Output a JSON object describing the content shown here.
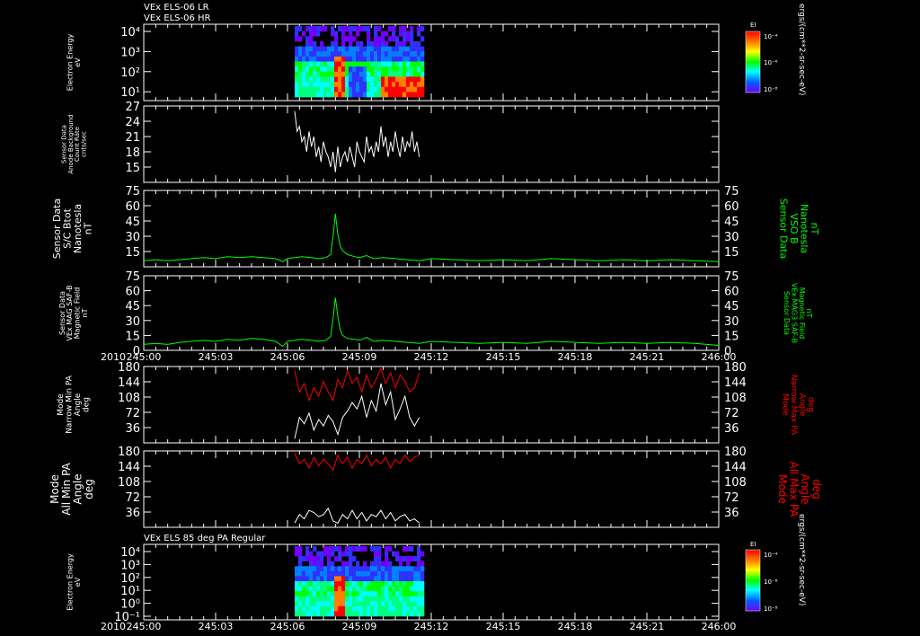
{
  "titles": {
    "top_line1": "VEx ELS-06 LR",
    "top_line2": "VEx ELS-06 HR",
    "bottom": "VEx ELS 85 deg PA Regular"
  },
  "time_axis": {
    "year": "2010",
    "ticks": [
      "245:00",
      "245:03",
      "245:06",
      "245:09",
      "245:12",
      "245:15",
      "245:18",
      "245:21",
      "246:00"
    ],
    "range_minutes": [
      0,
      24
    ]
  },
  "colorbar": {
    "label": "EI",
    "units": "ergs/(cm**2-sr-sec-eV)",
    "top_ticks": [
      "10⁻⁴",
      "10⁻⁶",
      "10⁻⁸"
    ],
    "bottom_ticks": [
      "10⁻⁴",
      "10⁻⁶",
      "10⁻⁸"
    ],
    "colors": [
      "#ff0000",
      "#ff8000",
      "#ffff00",
      "#00ff00",
      "#00ffff",
      "#0060ff",
      "#7000ff"
    ]
  },
  "colors": {
    "white": "#ffffff",
    "green": "#00ff00",
    "red": "#ff0000",
    "axis": "#ffffff"
  },
  "chart_data": [
    {
      "id": "spectrogram_top",
      "type": "heatmap",
      "ylabel_lines": [
        "Electron Energy",
        "eV"
      ],
      "y_scale": "log",
      "y_ticks": [
        "10⁴",
        "10³",
        "10²",
        "10¹"
      ],
      "x_range_minutes": [
        6.3,
        11.7
      ],
      "description_values": {
        "peak_time_minutes": 8.1
      }
    },
    {
      "id": "background_count",
      "type": "line",
      "ylabel_lines": [
        "Sensor Data",
        "Anode Background",
        "Count Rate",
        "cnts/sec"
      ],
      "ylim": [
        12,
        27
      ],
      "y_ticks": [
        15,
        18,
        21,
        24,
        27
      ],
      "series": [
        {
          "color": "white",
          "x": [
            6.3,
            6.4,
            6.5,
            6.6,
            6.7,
            6.8,
            6.9,
            7.0,
            7.1,
            7.2,
            7.3,
            7.4,
            7.5,
            7.6,
            7.7,
            7.8,
            7.9,
            8.0,
            8.1,
            8.2,
            8.3,
            8.4,
            8.5,
            8.6,
            8.7,
            8.8,
            8.9,
            9.0,
            9.1,
            9.2,
            9.3,
            9.4,
            9.5,
            9.6,
            9.7,
            9.8,
            9.9,
            10.0,
            10.1,
            10.2,
            10.3,
            10.4,
            10.5,
            10.6,
            10.7,
            10.8,
            10.9,
            11.0,
            11.1,
            11.2,
            11.3,
            11.4,
            11.5
          ],
          "y": [
            26,
            22,
            23,
            20,
            21,
            18,
            22,
            19,
            21,
            17,
            19,
            16,
            20,
            18,
            17,
            15,
            18,
            14,
            19,
            15,
            17,
            18,
            16,
            19,
            17,
            15,
            20,
            18,
            17,
            16,
            21,
            18,
            19,
            17,
            20,
            18,
            23,
            19,
            21,
            17,
            20,
            18,
            22,
            19,
            17,
            21,
            18,
            20,
            19,
            22,
            18,
            20,
            17
          ]
        }
      ]
    },
    {
      "id": "bmag_sc",
      "type": "line",
      "ylabel_lines": [
        "Sensor Data",
        "S/C Btot",
        "Nanotesla",
        "nT"
      ],
      "right_label_lines": [
        "Sensor Data",
        "VSO B",
        "Nanotesla",
        "nT"
      ],
      "ylim": [
        0,
        75
      ],
      "y_ticks": [
        15,
        30,
        45,
        60,
        75
      ],
      "series": [
        {
          "color": "green",
          "x": [
            0,
            0.5,
            1,
            1.5,
            2,
            2.5,
            3,
            3.5,
            4,
            4.5,
            5,
            5.5,
            5.8,
            6,
            6.3,
            6.6,
            7,
            7.3,
            7.6,
            7.8,
            7.9,
            8.0,
            8.1,
            8.2,
            8.3,
            8.5,
            8.8,
            9,
            9.3,
            9.6,
            10,
            10.5,
            11,
            11.5,
            12,
            13,
            14,
            15,
            16,
            17,
            18,
            19,
            20,
            21,
            22,
            23,
            24
          ],
          "y": [
            6,
            7,
            6,
            7,
            8,
            9,
            8,
            10,
            9,
            10,
            9,
            8,
            5,
            8,
            9,
            10,
            9,
            8,
            9,
            12,
            30,
            52,
            32,
            20,
            16,
            12,
            10,
            9,
            11,
            8,
            9,
            8,
            7,
            6,
            8,
            7,
            6,
            7,
            6,
            8,
            7,
            6,
            7,
            6,
            7,
            6,
            5
          ]
        }
      ]
    },
    {
      "id": "bmag_saf",
      "type": "line",
      "ylabel_lines": [
        "Sensor Data",
        "VEx MAG SAF-B",
        "Magnetic Field",
        "nT"
      ],
      "right_label_lines": [
        "Sensor Data",
        "VEx MAG3 SAF-B",
        "Magnetic Field",
        "nT"
      ],
      "ylim": [
        0,
        75
      ],
      "y_ticks": [
        0,
        15,
        30,
        45,
        60,
        75
      ],
      "series": [
        {
          "color": "green",
          "x": [
            0,
            0.5,
            1,
            1.5,
            2,
            2.5,
            3,
            3.5,
            4,
            4.5,
            5,
            5.5,
            5.8,
            6,
            6.3,
            6.6,
            7,
            7.3,
            7.6,
            7.8,
            7.9,
            8.0,
            8.1,
            8.2,
            8.3,
            8.5,
            8.8,
            9,
            9.3,
            9.6,
            10,
            10.5,
            11,
            11.5,
            12,
            13,
            14,
            15,
            16,
            17,
            18,
            19,
            20,
            21,
            22,
            23,
            24
          ],
          "y": [
            6,
            7,
            6,
            8,
            9,
            10,
            9,
            11,
            10,
            12,
            11,
            9,
            4,
            9,
            10,
            11,
            10,
            9,
            10,
            14,
            32,
            53,
            34,
            21,
            15,
            12,
            11,
            10,
            13,
            9,
            10,
            9,
            8,
            7,
            9,
            8,
            7,
            8,
            7,
            9,
            8,
            7,
            8,
            7,
            8,
            7,
            5
          ]
        }
      ]
    },
    {
      "id": "narrow_pa",
      "type": "line",
      "ylabel_lines": [
        "Mode",
        "Narrow Min PA",
        "Angle",
        "deg"
      ],
      "right_label_lines": [
        "Mode",
        "Narrow Max PA",
        "Angle",
        "deg"
      ],
      "ylim": [
        0,
        180
      ],
      "y_ticks": [
        36,
        72,
        108,
        144,
        180
      ],
      "series": [
        {
          "name": "Narrow Min PA",
          "color": "white",
          "x": [
            6.3,
            6.5,
            6.7,
            6.9,
            7.1,
            7.3,
            7.5,
            7.7,
            7.9,
            8.1,
            8.3,
            8.5,
            8.7,
            8.9,
            9.1,
            9.3,
            9.5,
            9.7,
            9.9,
            10.1,
            10.3,
            10.5,
            10.7,
            10.9,
            11.1,
            11.3,
            11.5
          ],
          "y": [
            10,
            60,
            45,
            70,
            30,
            55,
            40,
            65,
            50,
            20,
            60,
            75,
            95,
            80,
            110,
            60,
            100,
            75,
            140,
            90,
            120,
            55,
            80,
            110,
            60,
            40,
            60
          ]
        },
        {
          "name": "Narrow Max PA",
          "color": "red",
          "x": [
            6.3,
            6.5,
            6.7,
            6.9,
            7.1,
            7.3,
            7.5,
            7.7,
            7.9,
            8.1,
            8.3,
            8.5,
            8.7,
            8.9,
            9.1,
            9.3,
            9.5,
            9.7,
            9.9,
            10.1,
            10.3,
            10.5,
            10.7,
            10.9,
            11.1,
            11.3,
            11.5
          ],
          "y": [
            170,
            120,
            140,
            100,
            130,
            110,
            145,
            120,
            100,
            150,
            130,
            170,
            140,
            155,
            120,
            160,
            130,
            150,
            175,
            140,
            165,
            130,
            160,
            145,
            120,
            130,
            165
          ]
        }
      ]
    },
    {
      "id": "all_pa",
      "type": "line",
      "ylabel_lines": [
        "Mode",
        "All Min PA",
        "Angle",
        "deg"
      ],
      "right_label_lines": [
        "Mode",
        "All Max PA",
        "Angle",
        "deg"
      ],
      "ylim": [
        0,
        180
      ],
      "y_ticks": [
        36,
        72,
        108,
        144,
        180
      ],
      "series": [
        {
          "name": "All Min PA",
          "color": "white",
          "x": [
            6.3,
            6.5,
            6.7,
            6.9,
            7.1,
            7.3,
            7.5,
            7.7,
            7.9,
            8.1,
            8.3,
            8.5,
            8.7,
            8.9,
            9.1,
            9.3,
            9.5,
            9.7,
            9.9,
            10.1,
            10.3,
            10.5,
            10.7,
            10.9,
            11.1,
            11.3,
            11.5
          ],
          "y": [
            10,
            30,
            20,
            40,
            35,
            25,
            30,
            45,
            15,
            10,
            30,
            20,
            40,
            20,
            35,
            15,
            30,
            25,
            40,
            20,
            35,
            15,
            25,
            30,
            15,
            20,
            10
          ]
        },
        {
          "name": "All Max PA",
          "color": "red",
          "x": [
            6.3,
            6.5,
            6.7,
            6.9,
            7.1,
            7.3,
            7.5,
            7.7,
            7.9,
            8.1,
            8.3,
            8.5,
            8.7,
            8.9,
            9.1,
            9.3,
            9.5,
            9.7,
            9.9,
            10.1,
            10.3,
            10.5,
            10.7,
            10.9,
            11.1,
            11.3,
            11.5
          ],
          "y": [
            175,
            150,
            160,
            140,
            165,
            145,
            160,
            150,
            135,
            170,
            150,
            165,
            140,
            160,
            150,
            170,
            145,
            160,
            150,
            165,
            140,
            160,
            150,
            170,
            155,
            165,
            170
          ]
        }
      ]
    },
    {
      "id": "spectrogram_bottom",
      "type": "heatmap",
      "ylabel_lines": [
        "Electron Energy",
        "eV"
      ],
      "y_scale": "log",
      "y_ticks": [
        "10⁴",
        "10³",
        "10²",
        "10¹",
        "10⁰",
        "10⁻¹"
      ],
      "x_range_minutes": [
        6.3,
        11.7
      ],
      "description_values": {
        "peak_time_minutes": 8.1
      }
    }
  ]
}
